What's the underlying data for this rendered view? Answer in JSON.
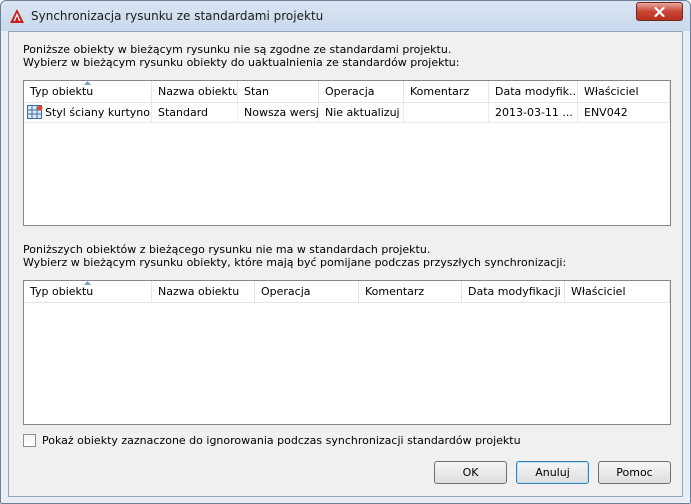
{
  "window": {
    "title": "Synchronizacja rysunku ze standardami projektu"
  },
  "section1": {
    "line1": "Poniższe obiekty w bieżącym rysunku nie są zgodne ze standardami projektu.",
    "line2": "Wybierz w bieżącym rysunku obiekty do uaktualnienia ze standardów projektu:",
    "columns": [
      "Typ obiektu",
      "Nazwa obiektu",
      "Stan",
      "Operacja",
      "Komentarz",
      "Data modyfik...",
      "Właściciel"
    ],
    "rows": [
      [
        "Styl ściany kurtyno...",
        "Standard",
        "Nowsza wersja",
        "Nie aktualizuj",
        "",
        "2013-03-11 ...",
        "ENV042"
      ]
    ]
  },
  "section2": {
    "line1": "Poniższych obiektów z bieżącego rysunku nie ma w standardach projektu.",
    "line2": "Wybierz w bieżącym rysunku obiekty, które mają być pomijane podczas przyszłych synchronizacji:",
    "columns": [
      "Typ obiektu",
      "Nazwa obiektu",
      "Operacja",
      "Komentarz",
      "Data modyfikacji",
      "Właściciel"
    ],
    "rows": []
  },
  "checkbox": {
    "label": "Pokaż obiekty zaznaczone do ignorowania podczas synchronizacji standardów projektu",
    "checked": false
  },
  "buttons": {
    "ok": "OK",
    "cancel": "Anuluj",
    "help": "Pomoc"
  },
  "colors": {
    "app_icon": "#c8231b",
    "close_button": "#c74534"
  }
}
